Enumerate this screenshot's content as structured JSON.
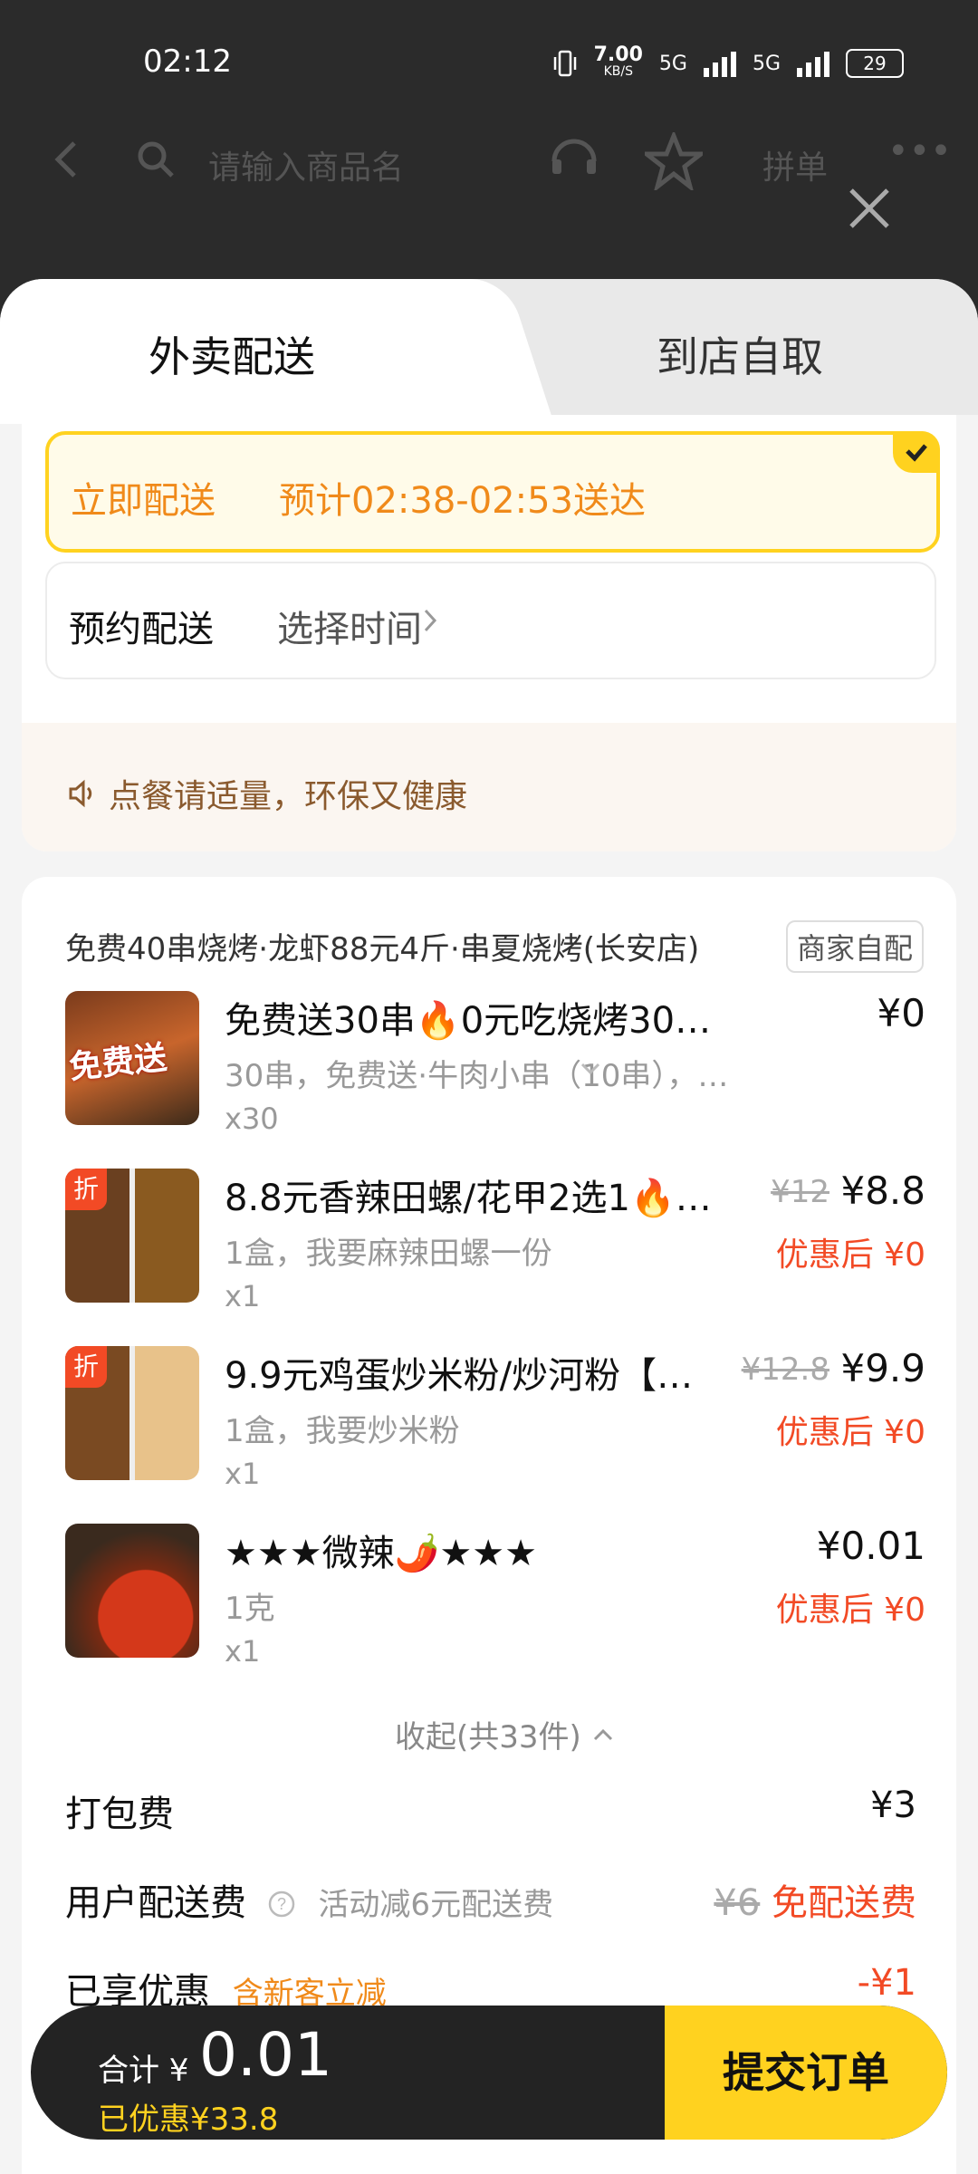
{
  "status": {
    "time": "02:12",
    "speed": "7.00",
    "speed_unit": "KB/S",
    "net1": "5G",
    "net2": "5G",
    "battery": "29"
  },
  "bg_nav": {
    "search_placeholder": "请输入商品名",
    "group_label": "拼单"
  },
  "tabs": {
    "delivery": "外卖配送",
    "pickup": "到店自取"
  },
  "delivery_options": [
    {
      "label": "立即配送",
      "value": "预计02:38-02:53送达"
    },
    {
      "label": "预约配送",
      "value": "选择时间"
    }
  ],
  "tip": "点餐请适量，环保又健康",
  "order": {
    "shop_name": "免费40串烧烤·龙虾88元4斤·串夏烧烤(长安店)",
    "shop_badge": "商家自配",
    "items": [
      {
        "name": "免费送30串🔥0元吃烧烤30串🔥…",
        "spec": "30串，免费送·牛肉小串（10串），…",
        "qty": "x30",
        "price": "¥0",
        "thumb_text": "免费送"
      },
      {
        "name": "8.8元香辣田螺/花甲2选1🔥…",
        "spec": "1盒，我要麻辣田螺一份",
        "qty": "x1",
        "orig": "¥12",
        "price": "¥8.8",
        "discount": "优惠后 ¥0",
        "badge": "折"
      },
      {
        "name": "9.9元鸡蛋炒米粉/炒河粉【…",
        "spec": "1盒，我要炒米粉",
        "qty": "x1",
        "orig": "¥12.8",
        "price": "¥9.9",
        "discount": "优惠后 ¥0",
        "badge": "折"
      },
      {
        "name": "★★★微辣🌶️★★★",
        "spec": "1克",
        "qty": "x1",
        "price": "¥0.01",
        "discount": "优惠后 ¥0"
      }
    ],
    "collapse": "收起(共33件)",
    "packing": {
      "label": "打包费",
      "value": "¥3"
    },
    "delivery_fee": {
      "label": "用户配送费",
      "hint": "活动减6元配送费",
      "orig": "¥6",
      "value": "免配送费"
    },
    "partial_row": {
      "label": "已享优惠",
      "hint": "含新客立减",
      "value": "-¥1"
    }
  },
  "footer": {
    "total_label": "合计 ¥",
    "total": "0.01",
    "saved": "已优惠¥33.8",
    "submit": "提交订单"
  }
}
